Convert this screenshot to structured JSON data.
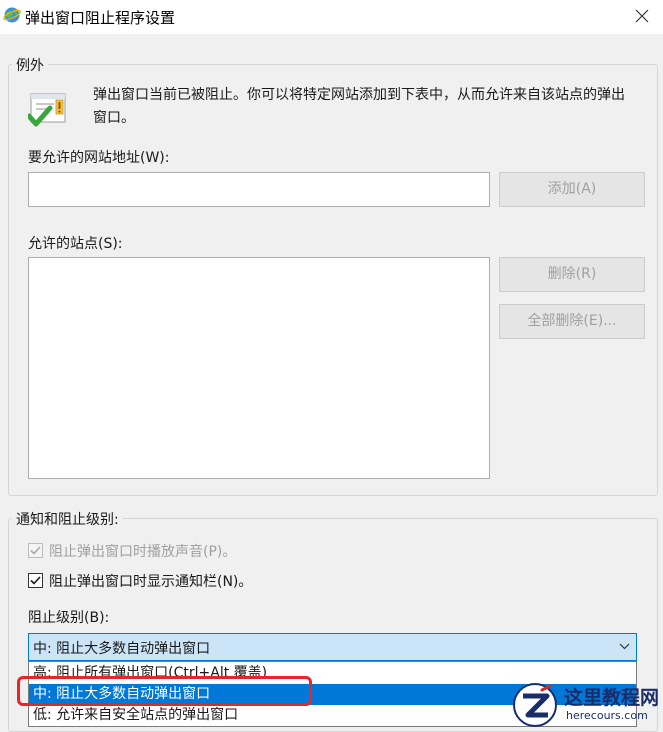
{
  "window": {
    "title": "弹出窗口阻止程序设置"
  },
  "exceptions": {
    "legend": "例外",
    "info_text": "弹出窗口当前已被阻止。你可以将特定网站添加到下表中，从而允许来自该站点的弹出窗口。",
    "address_label": "要允许的网站地址(W):",
    "address_value": "",
    "add_button": "添加(A)",
    "allowed_label": "允许的站点(S):",
    "allowed_sites": [],
    "remove_button": "删除(R)",
    "remove_all_button": "全部删除(E)..."
  },
  "notifications": {
    "legend": "通知和阻止级别:",
    "play_sound_label": "阻止弹出窗口时播放声音(P)。",
    "play_sound_checked": true,
    "show_bar_label": "阻止弹出窗口时显示通知栏(N)。",
    "show_bar_checked": true,
    "level_label": "阻止级别(B):",
    "level_selected": "中: 阻止大多数自动弹出窗口",
    "level_options": [
      "高: 阻止所有弹出窗口(Ctrl+Alt 覆盖)",
      "中: 阻止大多数自动弹出窗口",
      "低: 允许来自安全站点的弹出窗口"
    ]
  },
  "watermark": {
    "title": "这里教程网",
    "url": "herecours.com"
  },
  "colors": {
    "accent": "#0078d7",
    "highlight": "#e8262a"
  }
}
